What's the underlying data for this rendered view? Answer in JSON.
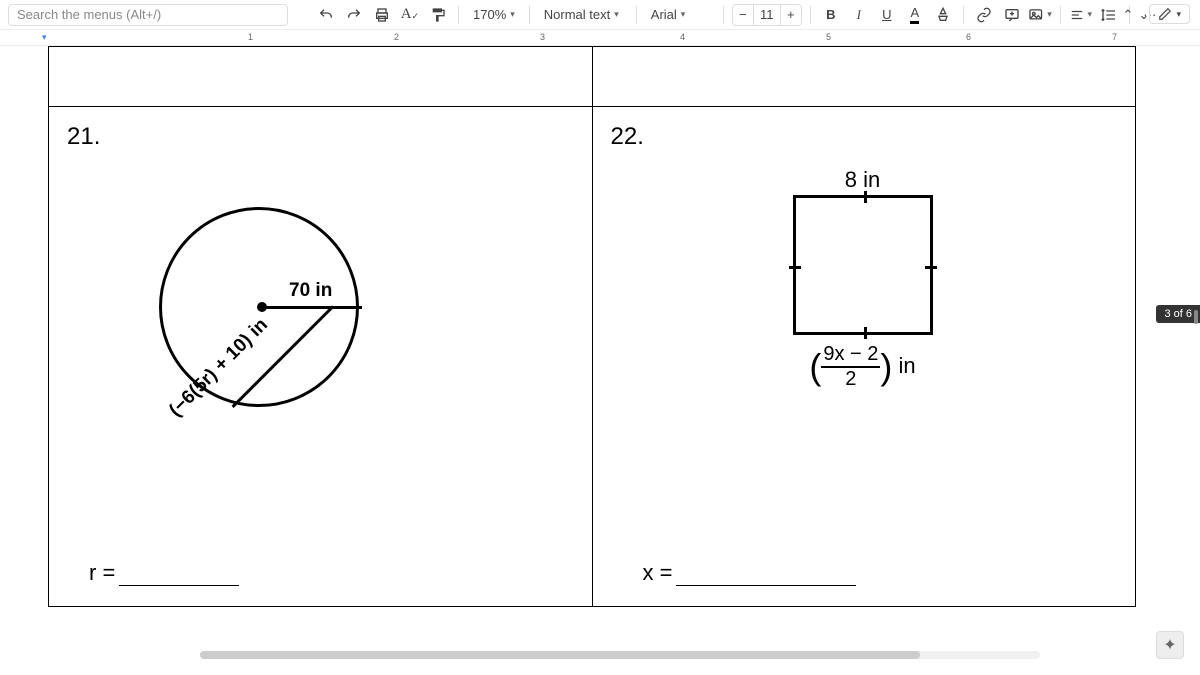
{
  "toolbar": {
    "search_placeholder": "Search the menus (Alt+/)",
    "zoom": "170%",
    "style": "Normal text",
    "font": "Arial",
    "font_size": "11",
    "minus": "−",
    "plus": "+",
    "bold": "B",
    "italic": "I",
    "underline": "U",
    "text_color": "A",
    "more": "···"
  },
  "ruler": {
    "n1": "1",
    "n2": "2",
    "n3": "3",
    "n4": "4",
    "n5": "5",
    "n6": "6",
    "n7": "7"
  },
  "q21": {
    "num": "21.",
    "radius_label": "70 in",
    "diagonal_label": "(−6(5r) + 10) in",
    "answer_prefix": "r ="
  },
  "q22": {
    "num": "22.",
    "top_label": "8 in",
    "frac_num": "9x − 2",
    "frac_den": "2",
    "unit": " in",
    "answer_prefix": "x ="
  },
  "page_indicator": "3 of 6"
}
